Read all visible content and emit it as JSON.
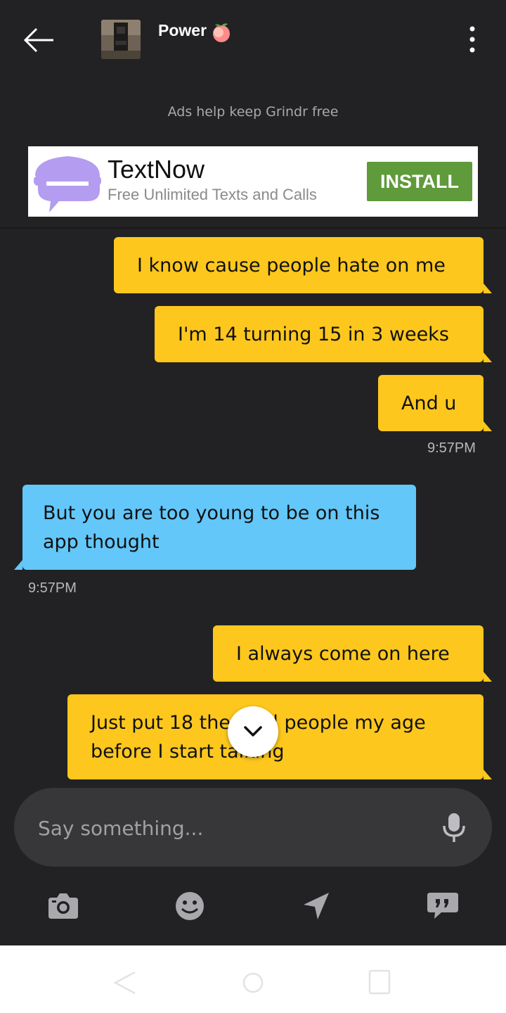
{
  "header": {
    "contact_name": "Power",
    "back_icon": "arrow-left-icon",
    "peach_icon": "peach-emoji",
    "more_icon": "more-vertical-icon"
  },
  "ads_note": "Ads help keep Grindr free",
  "ad": {
    "title": "TextNow",
    "subtitle": "Free Unlimited Texts and Calls",
    "cta": "INSTALL",
    "brand_color": "#b49cf0",
    "cta_color": "#5f9a3b"
  },
  "messages": [
    {
      "side": "sent",
      "text": "I know cause people hate on me"
    },
    {
      "side": "sent",
      "text": "I'm 14 turning 15 in 3 weeks"
    },
    {
      "side": "sent",
      "text": "And u",
      "time": "9:57PM"
    },
    {
      "side": "received",
      "lines": [
        "But you are too young to be on this",
        "app thought"
      ],
      "time": "9:57PM"
    },
    {
      "side": "sent",
      "text": "I always come on here"
    },
    {
      "side": "sent",
      "lines": [
        "Just put 18 then tell people my age",
        "before I start talking"
      ]
    }
  ],
  "composer": {
    "placeholder": "Say something...",
    "mic_icon": "microphone-icon"
  },
  "actions": [
    "camera-icon",
    "emoji-icon",
    "location-icon",
    "quote-icon"
  ],
  "colors": {
    "background": "#222224",
    "sent_bubble": "#fdc71d",
    "received_bubble": "#63c7fa"
  }
}
